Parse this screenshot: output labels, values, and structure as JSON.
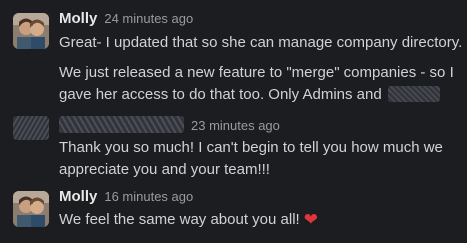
{
  "messages": [
    {
      "author": "Molly",
      "time": "24 minutes ago",
      "paragraphs": [
        [
          "Great- I updated that so she can manage company directory."
        ],
        [
          "We just released a new feature to \"merge\" companies - so I",
          "gave her access to do that too. Only Admins and"
        ]
      ]
    },
    {
      "time": "23 minutes ago",
      "lines": [
        "Thank you so much!  I can't begin to tell you how much we",
        "appreciate you and your team!!!"
      ]
    },
    {
      "author": "Molly",
      "time": "16 minutes ago",
      "lines": [
        "We feel the same way about you all!"
      ],
      "emoji": "red-heart"
    }
  ],
  "colors": {
    "background": "#1b1d21",
    "text": "#d1d2d3",
    "timestamp": "#9a9b9d",
    "heart": "#e0353b"
  }
}
